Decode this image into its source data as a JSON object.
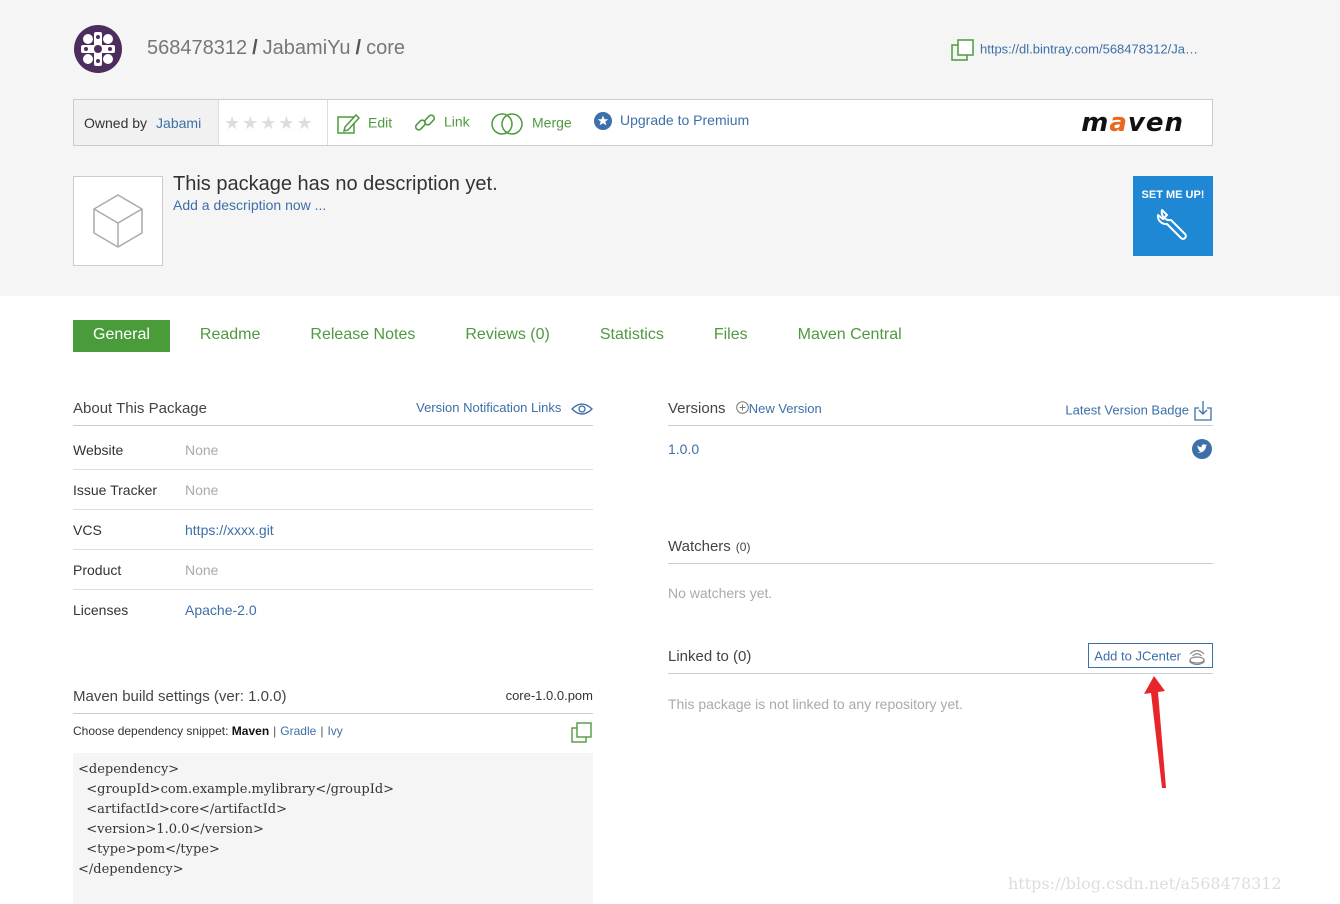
{
  "header": {
    "breadcrumb": {
      "user": "568478312",
      "repo": "JabamiYu",
      "package": "core",
      "separator": "/"
    },
    "download_url": "https://dl.bintray.com/568478312/Ja…"
  },
  "action_bar": {
    "owned_by_label": "Owned by",
    "owner": "Jabami",
    "rating_stars": "★★★★★",
    "rating_value": 0,
    "edit_label": "Edit",
    "link_label": "Link",
    "merge_label": "Merge",
    "upgrade_label": "Upgrade to Premium",
    "repo_type_logo": "maven"
  },
  "package": {
    "description": "This package has no description yet.",
    "add_description": "Add a description now ...",
    "setup_label": "SET ME UP!"
  },
  "tabs": [
    {
      "label": "General",
      "active": true
    },
    {
      "label": "Readme"
    },
    {
      "label": "Release Notes"
    },
    {
      "label": "Reviews (0)"
    },
    {
      "label": "Statistics"
    },
    {
      "label": "Files"
    },
    {
      "label": "Maven Central"
    }
  ],
  "about": {
    "title": "About This Package",
    "notification_links": "Version Notification Links",
    "rows": [
      {
        "key": "Website",
        "value": "None"
      },
      {
        "key": "Issue Tracker",
        "value": "None"
      },
      {
        "key": "VCS",
        "value": "https://xxxx.git"
      },
      {
        "key": "Product",
        "value": "None"
      },
      {
        "key": "Licenses",
        "value": "Apache-2.0"
      }
    ]
  },
  "maven_build": {
    "title": "Maven build settings (ver: 1.0.0)",
    "file": "core-1.0.0.pom",
    "choose_label": "Choose dependency snippet:",
    "options": [
      "Maven",
      "Gradle",
      "Ivy"
    ],
    "selected": "Maven",
    "code": "<dependency>\n  <groupId>com.example.mylibrary</groupId>\n  <artifactId>core</artifactId>\n  <version>1.0.0</version>\n  <type>pom</type>\n</dependency>"
  },
  "versions": {
    "title": "Versions",
    "new_version": "New Version",
    "badge": "Latest Version Badge",
    "items": [
      "1.0.0"
    ]
  },
  "watchers": {
    "title": "Watchers",
    "count": "(0)",
    "empty": "No watchers yet."
  },
  "linked": {
    "title": "Linked to (0)",
    "add_jcenter": "Add to JCenter",
    "empty": "This package is not linked to any repository yet."
  },
  "watermark": "https://blog.csdn.net/a568478312",
  "colors": {
    "link": "#3d6fa8",
    "green": "#4f9a3f",
    "active_tab": "#4a9c3b",
    "setup_button": "#1e88d4",
    "annotation_arrow": "#e8262a"
  }
}
